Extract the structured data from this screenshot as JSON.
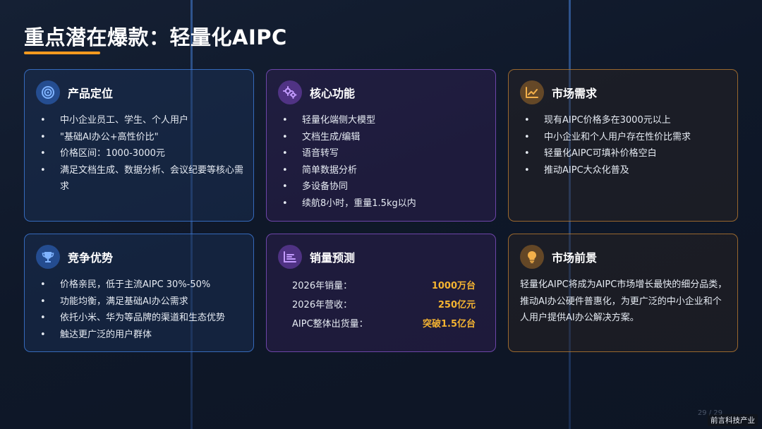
{
  "title": "重点潜在爆款：轻量化AIPC",
  "cards": {
    "positioning": {
      "title": "产品定位",
      "icon": "target-icon",
      "items": [
        "中小企业员工、学生、个人用户",
        "\"基础AI办公+高性价比\"",
        "价格区间：1000-3000元",
        "满足文档生成、数据分析、会议纪要等核心需求"
      ]
    },
    "features": {
      "title": "核心功能",
      "icon": "gears-icon",
      "items": [
        "轻量化端侧大模型",
        "文档生成/编辑",
        "语音转写",
        "简单数据分析",
        "多设备协同",
        "续航8小时，重量1.5kg以内"
      ]
    },
    "demand": {
      "title": "市场需求",
      "icon": "line-chart-icon",
      "items": [
        "现有AIPC价格多在3000元以上",
        "中小企业和个人用户存在性价比需求",
        "轻量化AIPC可填补价格空白",
        "推动AIPC大众化普及"
      ]
    },
    "advantage": {
      "title": "竞争优势",
      "icon": "trophy-icon",
      "items": [
        "价格亲民，低于主流AIPC 30%-50%",
        "功能均衡，满足基础AI办公需求",
        "依托小米、华为等品牌的渠道和生态优势",
        "触达更广泛的用户群体"
      ]
    },
    "forecast": {
      "title": "销量预测",
      "icon": "bar-chart-icon",
      "rows": [
        {
          "label": "2026年销量：",
          "value": "1000万台"
        },
        {
          "label": "2026年营收：",
          "value": "250亿元"
        },
        {
          "label": "AIPC整体出货量：",
          "value": "突破1.5亿台"
        }
      ]
    },
    "outlook": {
      "title": "市场前景",
      "icon": "lightbulb-icon",
      "text": "轻量化AIPC将成为AIPC市场增长最快的细分品类，推动AI办公硬件普惠化，为更广泛的中小企业和个人用户提供AI办公解决方案。"
    }
  },
  "page_number": "29 / 29",
  "watermark": "前言科技产业",
  "colors": {
    "accent": "#f39a1f",
    "blue": "#4082e6",
    "purple": "#8854cd",
    "orange": "#c48232",
    "value": "#f5b431"
  }
}
